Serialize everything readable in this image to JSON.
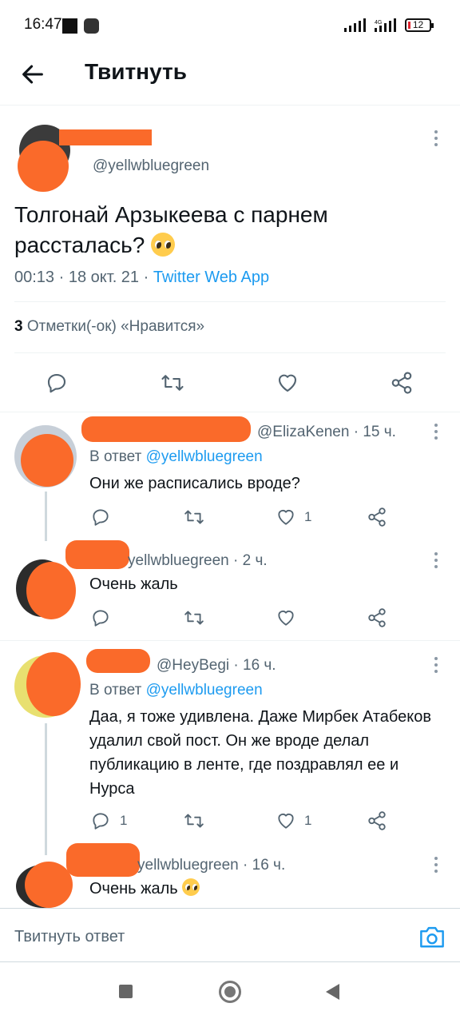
{
  "status_bar": {
    "time": "16:47",
    "network": "4G",
    "battery": "12"
  },
  "header": {
    "title": "Твитнуть"
  },
  "main_tweet": {
    "handle": "@yellwbluegreen",
    "text": "Толгонай Арзыкеева с парнем рассталась?",
    "time": "00:13",
    "date": "18 окт. 21",
    "source": "Twitter Web App",
    "likes_count": "3",
    "likes_label": "Отметки(-ок) «Нравится»"
  },
  "replies": [
    {
      "handle": "@ElizaKenen",
      "time_ago": "15 ч.",
      "in_reply_label": "В ответ",
      "in_reply_to": "@yellwbluegreen",
      "text": "Они же расписались вроде?",
      "reply_count": "",
      "like_count": "1"
    },
    {
      "handle_visible": "yellwbluegreen",
      "time_ago": "2 ч.",
      "text": "Очень жаль",
      "reply_count": "",
      "like_count": ""
    },
    {
      "handle": "@HeyBegi",
      "time_ago": "16 ч.",
      "in_reply_label": "В ответ",
      "in_reply_to": "@yellwbluegreen",
      "text": "Даа, я тоже удивлена. Даже Мирбек Атабеков удалил свой пост. Он же вроде делал публикацию в ленте, где поздравлял ее и Нурса",
      "reply_count": "1",
      "like_count": "1"
    },
    {
      "handle_visible": "yellwbluegreen",
      "time_ago": "16 ч.",
      "text": "Очень жаль"
    }
  ],
  "composer": {
    "placeholder": "Твитнуть ответ"
  },
  "colors": {
    "accent": "#1d9bf0",
    "redaction": "#fa6a2a",
    "secondary_text": "#536471"
  },
  "icons": [
    "back-arrow-icon",
    "more-icon",
    "reply-icon",
    "retweet-icon",
    "like-icon",
    "share-icon",
    "camera-icon",
    "pleading-face-emoji"
  ]
}
